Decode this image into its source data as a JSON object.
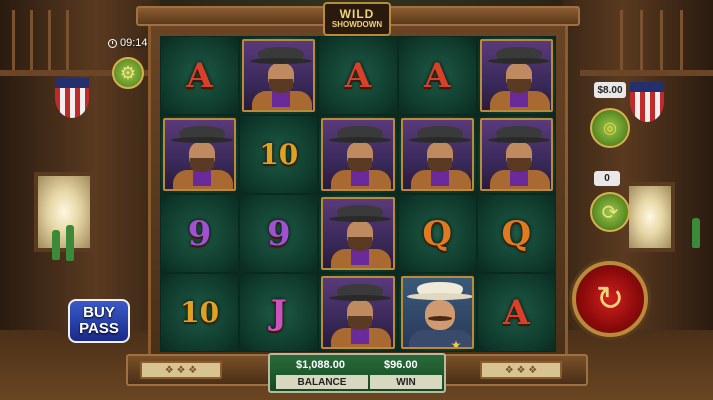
{
  "game": {
    "logo_line1": "WILD",
    "logo_line2": "SHOWDOWN"
  },
  "status": {
    "time": "09:14"
  },
  "controls": {
    "bet_amount": "$8.00",
    "autoplay_count": "0",
    "buy_pass_line1": "BUY",
    "buy_pass_line2": "PASS",
    "settings_icon": "gear-icon",
    "bet_icon": "coins-icon",
    "autoplay_icon": "autoplay-icon",
    "spin_icon": "spin-icon"
  },
  "panel": {
    "balance_value": "$1,088.00",
    "balance_label": "BALANCE",
    "win_value": "$96.00",
    "win_label": "WIN"
  },
  "reels": [
    [
      "A",
      "OUTLAW",
      "9",
      "10"
    ],
    [
      "OUTLAW",
      "10",
      "9",
      "J"
    ],
    [
      "A",
      "OUTLAW",
      "OUTLAW",
      "OUTLAW"
    ],
    [
      "A",
      "OUTLAW",
      "Q",
      "SHERIFF"
    ],
    [
      "OUTLAW",
      "OUTLAW",
      "Q",
      "A"
    ]
  ]
}
